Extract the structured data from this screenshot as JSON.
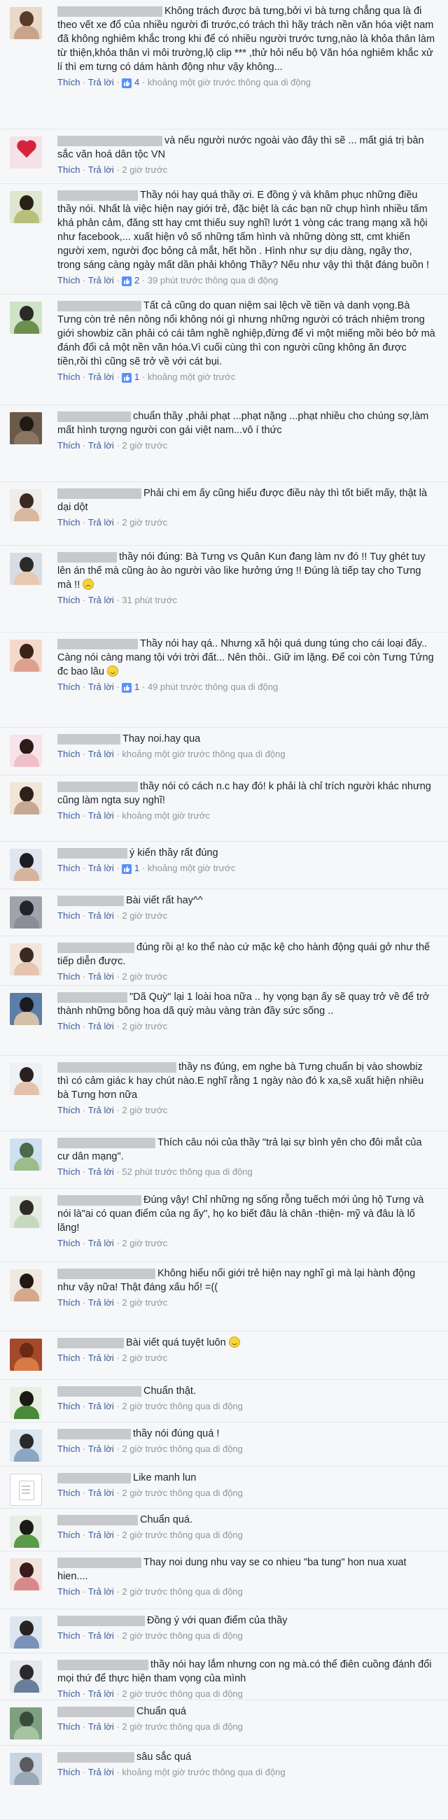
{
  "labels": {
    "like": "Thích",
    "reply": "Trả lời",
    "sep": "·"
  },
  "comments": [
    {
      "text": "Không trách được bà tưng,bởi vì bà tưng chẳng qua là đi theo vết xe đổ của nhiều người đi trước,có trách thì hãy trách nền văn hóa việt nam đã không nghiêm khắc trong khi để có nhiều người trước tưng,nào là khỏa thân làm từ thiện,khỏa thân vì môi trường,lộ clip *** ,thử hỏi nếu bộ Văn hóa nghiêm khắc xử lí thì em tưng có dám hành động như vậy không...",
      "likes": "4",
      "time": "khoảng một giờ trước thông qua di động"
    },
    {
      "text": "và nếu người nước ngoài vào đây thì sẽ ... mất giá trị bản sắc văn hoá dân tộc VN",
      "likes": "",
      "time": "2 giờ trước"
    },
    {
      "text": "Thầy nói hay quá thầy ơi. E đồng ý và khâm phục những điều thầy nói. Nhất là việc hiện nay giới trẻ, đặc biệt là các bạn nữ chụp hình nhiều tấm khá phản cảm, đăng stt hay cmt thiếu suy nghĩ! lướt 1 vòng các trang mạng xã hội như facebook,... xuất hiện vô số những tấm hình và những dòng stt, cmt khiến người xem, người đọc bỏng cả mắt, hết hồn . Hình như sự dịu dàng, ngây thơ, trong sáng càng ngày mất dần phải không Thầy? Nếu như vậy thì thật đáng buồn !",
      "likes": "2",
      "time": "39 phút trước thông qua di động"
    },
    {
      "text": "Tất cả cũng do quan niệm sai lệch về tiền và danh vọng.Bà Tưng còn trẻ nên nông nổi không nói gì nhưng những người có trách nhiệm trong giới showbiz cần phải có cái tâm nghề nghiệp,đừng để vì một miếng mồi béo bở mà đánh đổi cả một nền văn hóa.Vì cuối cùng thì con người cũng không ăn được tiền,rồi thì cũng sẽ trở về với cát bụi.",
      "likes": "1",
      "time": "khoảng một giờ trước"
    },
    {
      "text": "chuẩn thầy ,phải phạt ...phạt nặng ...phạt nhiều cho chúng sợ,làm mất hình tượng người con gái việt nam...vô í thức",
      "likes": "",
      "time": "2 giờ trước"
    },
    {
      "text": "Phải chi em ấy cũng hiểu được điều này thì tốt biết mấy, thật là dại dột",
      "likes": "",
      "time": "2 giờ trước"
    },
    {
      "text": "thầy nói đúng: Bà Tưng vs Quân Kun đang làm nv đó !! Tuy ghét tuy lên án thế mà cũng ào ào người vào like hưởng ứng !! Đúng là tiếp tay cho Tưng mà !!",
      "emoji": "sad",
      "likes": "",
      "time": "31 phút trước"
    },
    {
      "text": "Thầy nói hay qá.. Nhưng xã hội quá dung túng cho cái loại đấy.. Càng nói càng mang tội với trời đất... Nên thôi.. Giữ im lặng. Để coi còn Tưng Tửng đc bao lâu",
      "emoji": "smile",
      "likes": "1",
      "time": "49 phút trước thông qua di động"
    },
    {
      "text": "Thay noi.hay qua",
      "likes": "",
      "time": "khoảng một giờ trước thông qua di động"
    },
    {
      "text": "thầy nói có cách n.c hay đó! k phải là chỉ trích người khác nhưng cũng làm ngta suy nghĩ!",
      "likes": "",
      "time": "khoảng một giờ trước"
    },
    {
      "text": "ý kiến thầy rất đúng",
      "likes": "1",
      "time": "khoảng một giờ trước"
    },
    {
      "text": "Bài viết rất hay^^",
      "likes": "",
      "time": "2 giờ trước"
    },
    {
      "text": "đúng rồi ạ! ko thể nào cứ mặc kệ cho hành động quái gở như thế tiếp diễn được.",
      "likes": "",
      "time": "2 giờ trước"
    },
    {
      "text": "\"Dã Quỳ\" lại 1 loài hoa nữa .. hy vọng bạn ấy sẽ quay trở về để trở thành những bông hoa dã quỳ màu vàng tràn đầy sức sống ..",
      "likes": "",
      "time": "2 giờ trước"
    },
    {
      "text": "thầy ns đúng, em nghe bà Tưng chuẩn bị vào showbiz thì có cảm giác k hay chút nào.E nghĩ rằng 1 ngày nào đó k xa,sẽ xuất hiện nhiều bà Tưng hơn nữa",
      "likes": "",
      "time": "2 giờ trước"
    },
    {
      "text": "Thích câu nói của thầy \"trả lại sự bình yên cho đôi mắt của cư dân mạng\".",
      "likes": "",
      "time": "52 phút trước thông qua di động"
    },
    {
      "text": "Đúng vậy! Chỉ những ng sống rỗng tuếch mới ủng hộ Tưng và nói là\"ai có quan điểm của ng ấy\", họ ko biết đâu là chân -thiện- mỹ và đâu là lố lăng!",
      "likes": "",
      "time": "2 giờ trước"
    },
    {
      "text": "Không hiểu nổi giới trẻ hiện nay nghĩ gì mà lại hành động như vậy nữa! Thật đáng xấu hổ! =((",
      "likes": "",
      "time": "2 giờ trước"
    },
    {
      "text": "Bài viết quá tuyệt luôn",
      "emoji": "smile",
      "likes": "",
      "time": "2 giờ trước"
    },
    {
      "text": "Chuẩn thật.",
      "likes": "",
      "time": "2 giờ trước thông qua di động"
    },
    {
      "text": "thầy nói đúng quá !",
      "likes": "",
      "time": "2 giờ trước thông qua di động"
    },
    {
      "text": "Like manh lun",
      "likes": "",
      "time": "2 giờ trước thông qua di động"
    },
    {
      "text": "Chuẩn quá.",
      "likes": "",
      "time": "2 giờ trước thông qua di động"
    },
    {
      "text": "Thay noi dung nhu vay se co nhieu \"ba tung\" hon nua xuat hien....",
      "likes": "",
      "time": "2 giờ trước thông qua di động"
    },
    {
      "text": "Đồng ý với quan điểm của thầy",
      "likes": "",
      "time": "2 giờ trước thông qua di động"
    },
    {
      "text": "thầy nói hay lắm nhưng con ng mà.có thể điên cuồng đánh đổi mọi thứ để thực hiện tham vọng của mình",
      "likes": "",
      "time": "2 giờ trước thông qua di động"
    },
    {
      "text": "Chuẩn quá",
      "likes": "",
      "time": "2 giờ trước thông qua di động"
    },
    {
      "text": "sâu sắc quá",
      "likes": "",
      "time": "khoảng một giờ trước thông qua di động"
    }
  ]
}
